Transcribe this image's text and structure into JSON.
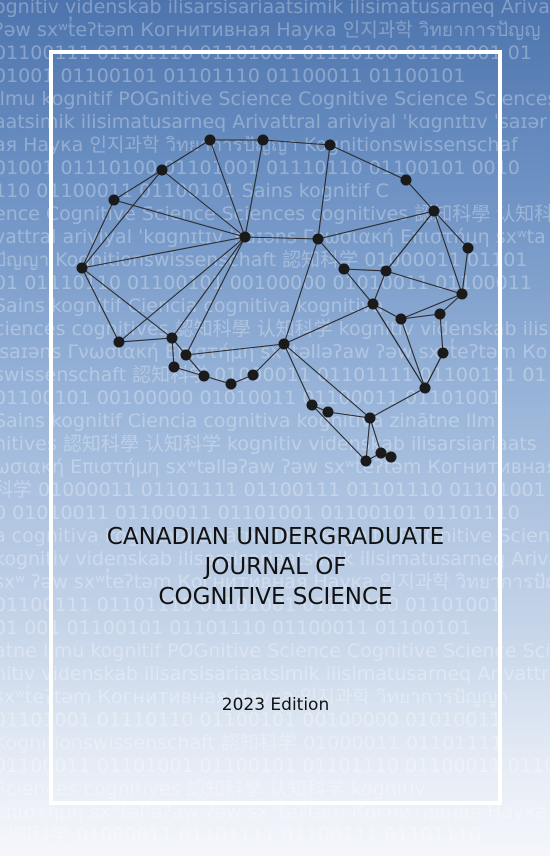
{
  "cover": {
    "title_lines": [
      "CANADIAN UNDERGRADUATE",
      "JOURNAL OF",
      "COGNITIVE SCIENCE"
    ],
    "edition": "2023 Edition"
  },
  "background_text": [
    "ognitiv videnskab ilisarsisariaatsimik ilisimatusarneq Arivattra",
    "ʔəw sxʷt̓eʔtəm Когнитивная Наука 인지과학 วิทยาการปัญญ",
    "01100111 01101110 01101001 01110100 01101001 01",
    "01001 01100101 01101110 01100011 01100101",
    "Ilmu kognitif POGnitive Science Cognitive Science Sciences",
    "aatsimik ilisimatusarneq Arivattral arivi̇yal ˈkɑgnɪtɪv ˈsaɪər",
    "ая Наука 인지과학 วิทยาการปัญญา Kognitionswissenschaf",
    "01001 01110100 01101001 01110110 01100101 0010",
    "110 01100011 01100101 Sains kognitif C",
    "ence Cognitive Science Sciences cognitives 認知科學 认知科",
    "vattral arivi̇yal ˈkɑgnɪtɪv ˈsaɪəns Γνωσιακή Επιστήμη sxʷta",
    "ปัญญา Kognitionswissenschaft 認知科学 01000011 01101",
    "01 01110110 01100101 00100000 01010011 01100011",
    "Sains kognitif Ciencia cognitiva kognitiva",
    "ciences cognitives 認知科學 认知科学 kognitiv videnskab ilis",
    "ˈsaɪəns Γνωσιακή Επιστήμη sxʷtəlləʔaw ʔəw sxʷt̓eʔtəm Ко",
    "swissenschaft 認知科学 01000011 01101111 01100111 01",
    "01100101 00100000 01010011 01100011 01101001",
    "Sains kognitif Ciencia cognitiva kognitivā zinātne Ilm",
    "nitives 認知科學 认知科学 kognitiv videnskab ilisarsiariaats",
    "ωσιακή Επιστήμη sxʷtəlləʔaw ʔəw sxʷt̓eʔtəm Когнитивная",
    "科学 01000011 01101111 01100111 01101110 01101001",
    "0 01010011 01100011 01101001 01100101 01101110",
    "a cognitiva kognitivā zinātne Ilmu kognitif POGnitive Science",
    "kognitiv videnskab ilisarsisariaatsimik ilisimatusarneq Ariva",
    "sxʷ ʔəw sxʷt̓eʔtəm Когнитивная Наука 인지과학 วิทยาการปัญญ",
    "01100111 01101110 01101001 01110100 01101001",
    "01 001 01100101 01101110 01100011 01100101",
    "atne Ilmu kognitif POGnitive Science Cognitive Science Sciences",
    "nitiv videnskab ilisarsisariaatsimik ilisimatusarneq Arivattral",
    "sxʷt̓eʔtəm Когнитивная Наука 인지과학 วิทยาการปัญญา",
    "01101001 01110110 01100101 00100000 01010011",
    "Kognitionswissenschaft 認知科学 01000011 01101111",
    "01100011 01101001 01100101 01101110 01100011 01100101",
    "Sciences cognitives 認知科學 认知科学 kognitiv",
    "Επιστήμη sxʷtəlləʔaw ʔəw sxʷt̓eʔtəm Когнитивная Наука",
    "認知科学 01000011 01101111 01100111 01101110"
  ],
  "palette": {
    "background_top": "#4d74ad",
    "background_bottom": "#f4f6fb",
    "frame": "#ffffff",
    "network_node": "#1a1a1a",
    "network_edge": "#2a2a2a",
    "title_text": "#111111"
  }
}
